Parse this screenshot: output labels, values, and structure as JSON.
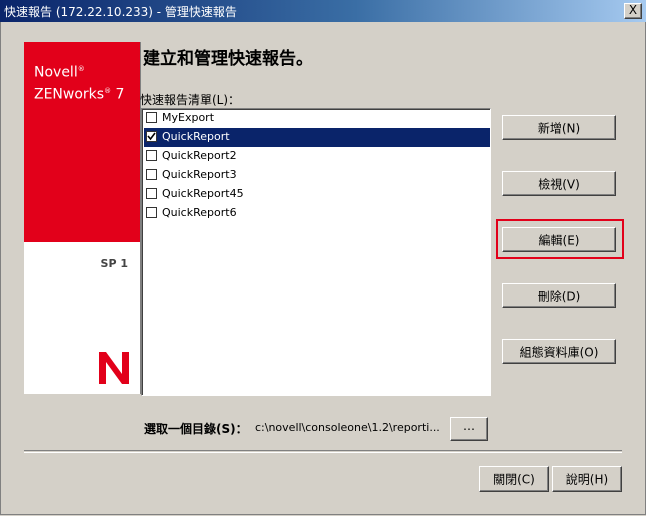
{
  "window": {
    "title": "快速報告 (172.22.10.233) - 管理快速報告",
    "close_label": "X"
  },
  "brand": {
    "line1": "Novell",
    "line2": "ZENworks",
    "version": "7",
    "reg_mark": "®",
    "sp": "SP 1",
    "colors": {
      "red": "#e2001a"
    }
  },
  "main": {
    "heading": "建立和管理快速報告。",
    "list_label": "快速報告清單(L)：",
    "items": [
      {
        "label": "MyExport",
        "checked": false,
        "selected": false
      },
      {
        "label": "QuickReport",
        "checked": true,
        "selected": true
      },
      {
        "label": "QuickReport2",
        "checked": false,
        "selected": false
      },
      {
        "label": "QuickReport3",
        "checked": false,
        "selected": false
      },
      {
        "label": "QuickReport45",
        "checked": false,
        "selected": false
      },
      {
        "label": "QuickReport6",
        "checked": false,
        "selected": false
      }
    ]
  },
  "buttons": {
    "new": "新增(N)",
    "view": "檢視(V)",
    "edit": "編輯(E)",
    "delete": "刪除(D)",
    "configure": "組態資料庫(O)",
    "browse": "⋯",
    "close": "關閉(C)",
    "help": "說明(H)"
  },
  "directory": {
    "label": "選取一個目錄(S)：",
    "value": "c:\\novell\\consoleone\\1.2\\reporti..."
  },
  "colors": {
    "selection": "#0a246a",
    "highlight_box": "#e2001a"
  }
}
